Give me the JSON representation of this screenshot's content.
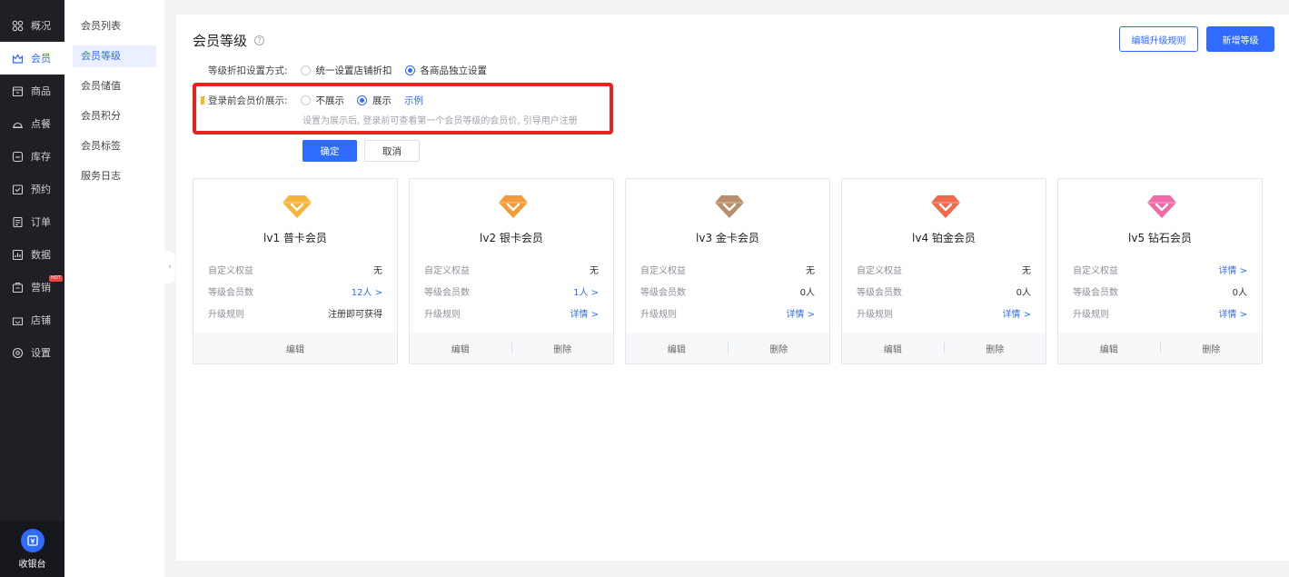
{
  "nav": [
    {
      "label": "概况",
      "icon": "grid-icon"
    },
    {
      "label": "会员",
      "icon": "crown-icon",
      "active": true
    },
    {
      "label": "商品",
      "icon": "store-icon"
    },
    {
      "label": "点餐",
      "icon": "dish-icon"
    },
    {
      "label": "库存",
      "icon": "inventory-icon"
    },
    {
      "label": "预约",
      "icon": "calendar-icon"
    },
    {
      "label": "订单",
      "icon": "order-icon"
    },
    {
      "label": "数据",
      "icon": "chart-icon"
    },
    {
      "label": "营销",
      "icon": "marketing-icon",
      "badge": "HOT"
    },
    {
      "label": "店铺",
      "icon": "shop-icon"
    },
    {
      "label": "设置",
      "icon": "settings-icon"
    }
  ],
  "cashier_label": "收银台",
  "subnav": [
    {
      "label": "会员列表"
    },
    {
      "label": "会员等级",
      "active": true
    },
    {
      "label": "会员储值"
    },
    {
      "label": "会员积分"
    },
    {
      "label": "会员标签"
    },
    {
      "label": "服务日志"
    }
  ],
  "page": {
    "title": "会员等级",
    "help": "?",
    "edit_rule_button": "编辑升级规则",
    "add_level_button": "新增等级"
  },
  "discount": {
    "label": "等级折扣设置方式:",
    "options": [
      "统一设置店铺折扣",
      "各商品独立设置"
    ],
    "selected": 1
  },
  "display": {
    "label": "登录前会员价展示:",
    "options": [
      "不展示",
      "展示"
    ],
    "selected": 1,
    "example_link": "示例",
    "hint": "设置为展示后, 登录前可查看第一个会员等级的会员价, 引导用户注册"
  },
  "actions": {
    "confirm": "确定",
    "cancel": "取消"
  },
  "colors": {
    "accent": "#2f6bff",
    "highlight": "#e8231f"
  },
  "levels": [
    {
      "name": "lv1 普卡会员",
      "gem_color": "#f7b43c",
      "rows": [
        {
          "label": "自定义权益",
          "value": "无"
        },
        {
          "label": "等级会员数",
          "value": "12人 >"
        },
        {
          "label": "升级规则",
          "value": "注册即可获得"
        }
      ],
      "footer": [
        "编辑"
      ]
    },
    {
      "name": "lv2 银卡会员",
      "gem_color": "#f59a3a",
      "rows": [
        {
          "label": "自定义权益",
          "value": "无"
        },
        {
          "label": "等级会员数",
          "value": "1人 >"
        },
        {
          "label": "升级规则",
          "value": "详情 >"
        }
      ],
      "footer": [
        "编辑",
        "删除"
      ]
    },
    {
      "name": "lv3 金卡会员",
      "gem_color": "#b88e6c",
      "rows": [
        {
          "label": "自定义权益",
          "value": "无"
        },
        {
          "label": "等级会员数",
          "value": "0人"
        },
        {
          "label": "升级规则",
          "value": "详情 >"
        }
      ],
      "footer": [
        "编辑",
        "删除"
      ]
    },
    {
      "name": "lv4 铂金会员",
      "gem_color": "#f0694a",
      "rows": [
        {
          "label": "自定义权益",
          "value": "无"
        },
        {
          "label": "等级会员数",
          "value": "0人"
        },
        {
          "label": "升级规则",
          "value": "详情 >"
        }
      ],
      "footer": [
        "编辑",
        "删除"
      ]
    },
    {
      "name": "lv5 钻石会员",
      "gem_color": "#f06aa8",
      "rows": [
        {
          "label": "自定义权益",
          "value": "详情 >"
        },
        {
          "label": "等级会员数",
          "value": "0人"
        },
        {
          "label": "升级规则",
          "value": "详情 >"
        }
      ],
      "footer": [
        "编辑",
        "删除"
      ]
    }
  ]
}
